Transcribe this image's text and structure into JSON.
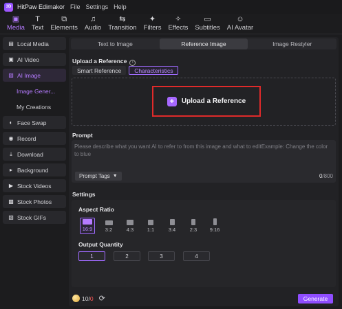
{
  "titlebar": {
    "app_title": "HitPaw Edimakor",
    "logo_text": "3D",
    "menus": [
      "File",
      "Settings",
      "Help"
    ]
  },
  "toolbar": {
    "tools": [
      {
        "label": "Media",
        "icon": "media-icon"
      },
      {
        "label": "Text",
        "icon": "text-icon"
      },
      {
        "label": "Elements",
        "icon": "elements-icon"
      },
      {
        "label": "Audio",
        "icon": "audio-icon"
      },
      {
        "label": "Transition",
        "icon": "transition-icon"
      },
      {
        "label": "Filters",
        "icon": "filters-icon"
      },
      {
        "label": "Effects",
        "icon": "effects-icon"
      },
      {
        "label": "Subtitles",
        "icon": "subtitles-icon"
      },
      {
        "label": "AI Avatar",
        "icon": "avatar-icon"
      }
    ],
    "active": "Media",
    "accent_color": "#b57bff"
  },
  "sidebar": {
    "items": [
      {
        "label": "Local Media"
      },
      {
        "label": "AI Video"
      },
      {
        "label": "AI Image"
      },
      {
        "label": "Image Gener..."
      },
      {
        "label": "My Creations"
      },
      {
        "label": "Face Swap"
      },
      {
        "label": "Record"
      },
      {
        "label": "Download"
      },
      {
        "label": "Background"
      },
      {
        "label": "Stock Videos"
      },
      {
        "label": "Stock Photos"
      },
      {
        "label": "Stock GIFs"
      }
    ]
  },
  "main": {
    "tabs": [
      "Text to Image",
      "Reference Image",
      "Image Restyler"
    ],
    "active_tab": "Reference Image",
    "upload_section_title": "Upload a Reference",
    "info_glyph": "i",
    "subtabs": [
      "Smart Reference",
      "Characteristics"
    ],
    "active_subtab": "Characteristics",
    "upload_button_label": "Upload a Reference",
    "prompt": {
      "title": "Prompt",
      "placeholder": "Please describe what you want AI to refer to from this image and what to editExample: Change the color to blue",
      "tags_label": "Prompt Tags",
      "count_current": "0",
      "count_max": "/800"
    },
    "settings": {
      "title": "Settings",
      "aspect_ratio_title": "Aspect Ratio",
      "ratios": [
        "16:9",
        "3:2",
        "4:3",
        "1:1",
        "3:4",
        "2:3",
        "9:16"
      ],
      "active_ratio": "16:9",
      "output_quantity_title": "Output Quantity",
      "quantities": [
        "1",
        "2",
        "3",
        "4"
      ],
      "active_quantity": "1"
    },
    "footer": {
      "credits_current": "10",
      "credits_sep": "/",
      "credits_cost": "0",
      "generate_label": "Generate",
      "generate_color": "#8f4dff"
    }
  }
}
